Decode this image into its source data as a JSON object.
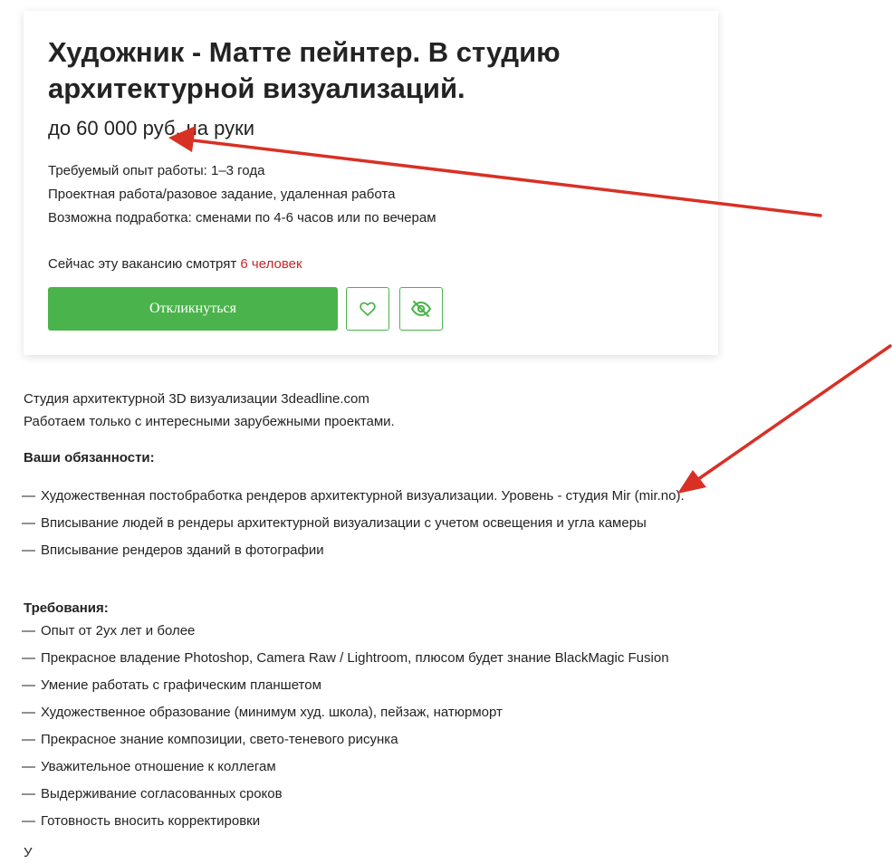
{
  "vacancy": {
    "title": "Художник - Матте пейнтер. В студию архитектурной визуализаций.",
    "salary": "до 60 000 руб. на руки",
    "details": [
      "Требуемый опыт работы: 1–3 года",
      "Проектная работа/разовое задание, удаленная работа",
      "Возможна подработка: сменами по 4-6 часов или по вечерам"
    ],
    "viewers_prefix": "Сейчас эту вакансию смотрят ",
    "viewers_count": "6 человек",
    "respond_label": "Откликнуться",
    "favorite_icon": "heart-icon",
    "hide_icon": "eye-crossed-icon"
  },
  "description": {
    "intro": [
      "Студия архитектурной 3D визуализации 3deadline.com",
      "Работаем только с интересными зарубежными проектами."
    ],
    "duties_heading": "Ваши обязанности:",
    "duties": [
      "Художественная постобработка рендеров архитектурной визуализации. Уровень - студия Mir (mir.no).",
      "Вписывание людей в рендеры архитектурной визуализации с учетом освещения и угла камеры",
      "Вписывание рендеров зданий в фотографии"
    ],
    "requirements_heading": "Требования:",
    "requirements": [
      "Опыт от 2ух лет и более",
      "Прекрасное владение Photoshop, Camera Raw / Lightroom, плюсом будет знание BlackMagic Fusion",
      "Умение работать с графическим планшетом",
      "Художественное образование (минимум худ. школа), пейзаж, натюрморт",
      "Прекрасное знание композиции, свето-теневого рисунка",
      "Уважительное отношение к коллегам",
      "Выдерживание согласованных сроков",
      "Готовность вносить корректировки"
    ],
    "dash": "—",
    "cut_off_text": "У"
  },
  "colors": {
    "accent_green": "#4bb34b",
    "viewers_red": "#c62828",
    "annotation_arrow": "#d93025"
  }
}
